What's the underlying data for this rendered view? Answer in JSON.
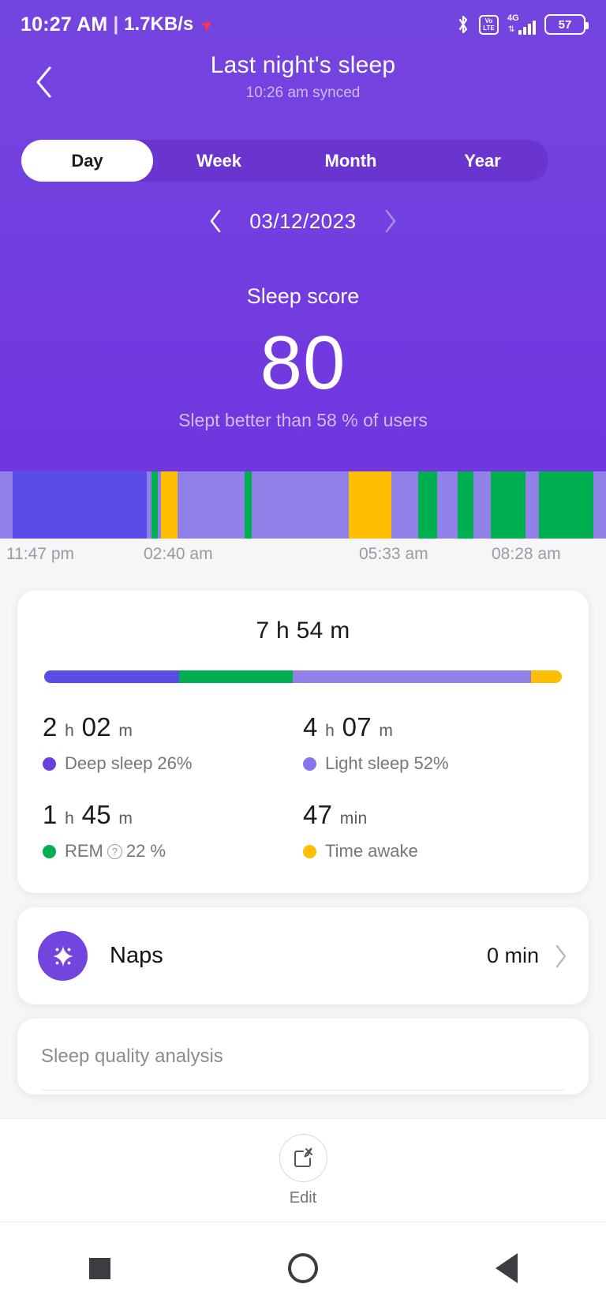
{
  "status_bar": {
    "clock": "10:27 AM",
    "separator": "|",
    "network_speed": "1.7KB/s",
    "upload_arrow_icon": "arrow-upward-icon",
    "bluetooth_icon": "bluetooth-icon",
    "volte_top": "Vo",
    "volte_bottom": "LTE",
    "network_gen": "4G",
    "data_arrows": "⇅",
    "battery_percent": "57"
  },
  "header": {
    "back_icon": "chevron-left-icon",
    "title": "Last night's sleep",
    "subtitle": "10:26 am synced"
  },
  "tabs": {
    "items": [
      {
        "label": "Day",
        "active": true
      },
      {
        "label": "Week",
        "active": false
      },
      {
        "label": "Month",
        "active": false
      },
      {
        "label": "Year",
        "active": false
      }
    ]
  },
  "date_nav": {
    "prev_icon": "chevron-left-icon",
    "date": "03/12/2023",
    "next_icon": "chevron-right-icon"
  },
  "sleep_score": {
    "label": "Sleep score",
    "value": "80",
    "note": "Slept better than 58 % of users"
  },
  "colors": {
    "hero_purple": "#7036DF",
    "deep": "#5B4BE8",
    "light": "#9180E8",
    "rem": "#00B050",
    "awake": "#FFBF00",
    "accent": "#7444DF"
  },
  "chart_data": {
    "type": "bar",
    "title": "Sleep stages hypnogram",
    "xlabel": "",
    "ylabel": "",
    "x_tick_labels": [
      "11:47 pm",
      "02:40 am",
      "05:33 am",
      "08:28 am"
    ],
    "legend": [
      "Deep sleep",
      "Light sleep",
      "REM",
      "Time awake"
    ],
    "legend_position": "below",
    "grid": false,
    "stage_colors": {
      "deep": "#5B4BE8",
      "light": "#9180E8",
      "rem": "#00B050",
      "awake": "#FFBF00"
    },
    "segments": [
      {
        "stage": "light",
        "width_pct": 2.1
      },
      {
        "stage": "deep",
        "width_pct": 22.1
      },
      {
        "stage": "light",
        "width_pct": 0.8
      },
      {
        "stage": "rem",
        "width_pct": 1.1
      },
      {
        "stage": "light",
        "width_pct": 0.5
      },
      {
        "stage": "awake",
        "width_pct": 2.7
      },
      {
        "stage": "light",
        "width_pct": 11.1
      },
      {
        "stage": "rem",
        "width_pct": 1.1
      },
      {
        "stage": "light",
        "width_pct": 16.1
      },
      {
        "stage": "awake",
        "width_pct": 7.0
      },
      {
        "stage": "light",
        "width_pct": 4.4
      },
      {
        "stage": "rem",
        "width_pct": 3.1
      },
      {
        "stage": "light",
        "width_pct": 0.4
      },
      {
        "stage": "light",
        "width_pct": 3.1
      },
      {
        "stage": "rem",
        "width_pct": 2.5
      },
      {
        "stage": "light",
        "width_pct": 2.9
      },
      {
        "stage": "rem",
        "width_pct": 5.7
      },
      {
        "stage": "light",
        "width_pct": 2.2
      },
      {
        "stage": "rem",
        "width_pct": 9.1
      },
      {
        "stage": "light",
        "width_pct": 2.0
      }
    ],
    "summary_bar": {
      "categories": [
        "Deep sleep",
        "REM",
        "Light sleep",
        "Time awake"
      ],
      "values": [
        26,
        22,
        46,
        6
      ],
      "unit": "%"
    }
  },
  "summary_card": {
    "total_label": "7 h 54 m",
    "stats": [
      {
        "value": "2",
        "unit1": "h",
        "value2": "02",
        "unit2": "m",
        "legend": "Deep sleep 26%",
        "color": "#6A3FE0",
        "has_info_icon": false
      },
      {
        "value": "4",
        "unit1": "h",
        "value2": "07",
        "unit2": "m",
        "legend": "Light sleep 52%",
        "color": "#8A74EB",
        "has_info_icon": false
      },
      {
        "value": "1",
        "unit1": "h",
        "value2": "45",
        "unit2": "m",
        "legend_pre": "REM",
        "legend_post": "22 %",
        "color": "#00B050",
        "has_info_icon": true,
        "info_icon": "question-circle-icon"
      },
      {
        "value": "47",
        "unit1": "min",
        "value2": "",
        "unit2": "",
        "legend": "Time awake",
        "color": "#FFBF00",
        "has_info_icon": false
      }
    ]
  },
  "naps_card": {
    "icon": "sparkle-icon",
    "label": "Naps",
    "value": "0 min",
    "chevron_icon": "chevron-right-icon"
  },
  "analysis_card": {
    "title": "Sleep quality analysis"
  },
  "edit_bar": {
    "icon": "edit-square-icon",
    "label": "Edit"
  },
  "nav_bar": {
    "recents_icon": "square-icon",
    "home_icon": "circle-icon",
    "back_icon": "triangle-back-icon"
  }
}
